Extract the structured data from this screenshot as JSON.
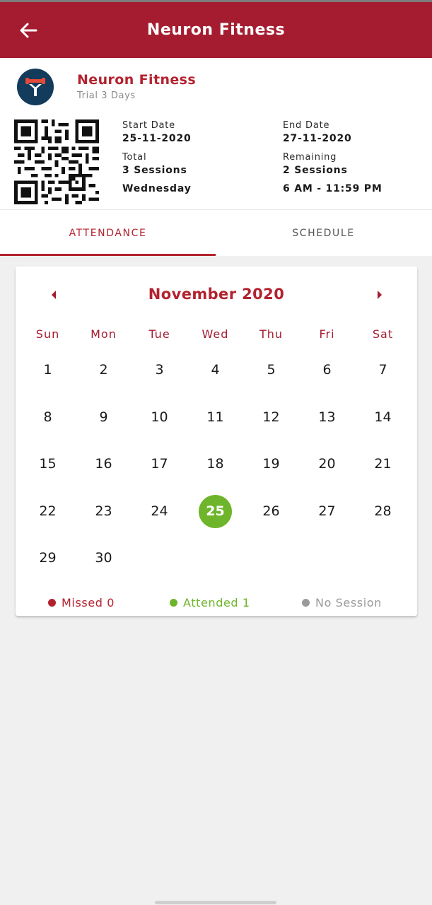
{
  "appbar": {
    "title": "Neuron Fitness",
    "back_icon": "arrow-left-icon"
  },
  "membership": {
    "gym_name": "Neuron Fitness",
    "plan": "Trial 3 Days",
    "logo_icon": "dumbbell-logo-icon",
    "start_date_label": "Start Date",
    "start_date": "25-11-2020",
    "end_date_label": "End Date",
    "end_date": "27-11-2020",
    "total_label": "Total",
    "total": "3 Sessions",
    "remaining_label": "Remaining",
    "remaining": "2 Sessions",
    "day": "Wednesday",
    "time": "6 AM - 11:59 PM"
  },
  "tabs": [
    {
      "label": "ATTENDANCE",
      "active": true
    },
    {
      "label": "SCHEDULE",
      "active": false
    }
  ],
  "calendar": {
    "month": "November 2020",
    "prev_icon": "triangle-left-icon",
    "next_icon": "triangle-right-icon",
    "weekdays": [
      "Sun",
      "Mon",
      "Tue",
      "Wed",
      "Thu",
      "Fri",
      "Sat"
    ],
    "first_weekday_index": 0,
    "days_in_month": 30,
    "attended_days": [
      25
    ]
  },
  "legend": {
    "missed": "Missed 0",
    "attended": "Attended 1",
    "no_session": "No Session"
  },
  "colors": {
    "brand": "#a51c30",
    "accent_text": "#b3222e",
    "attended": "#6fb52b",
    "no_session": "#9a9a9a"
  }
}
